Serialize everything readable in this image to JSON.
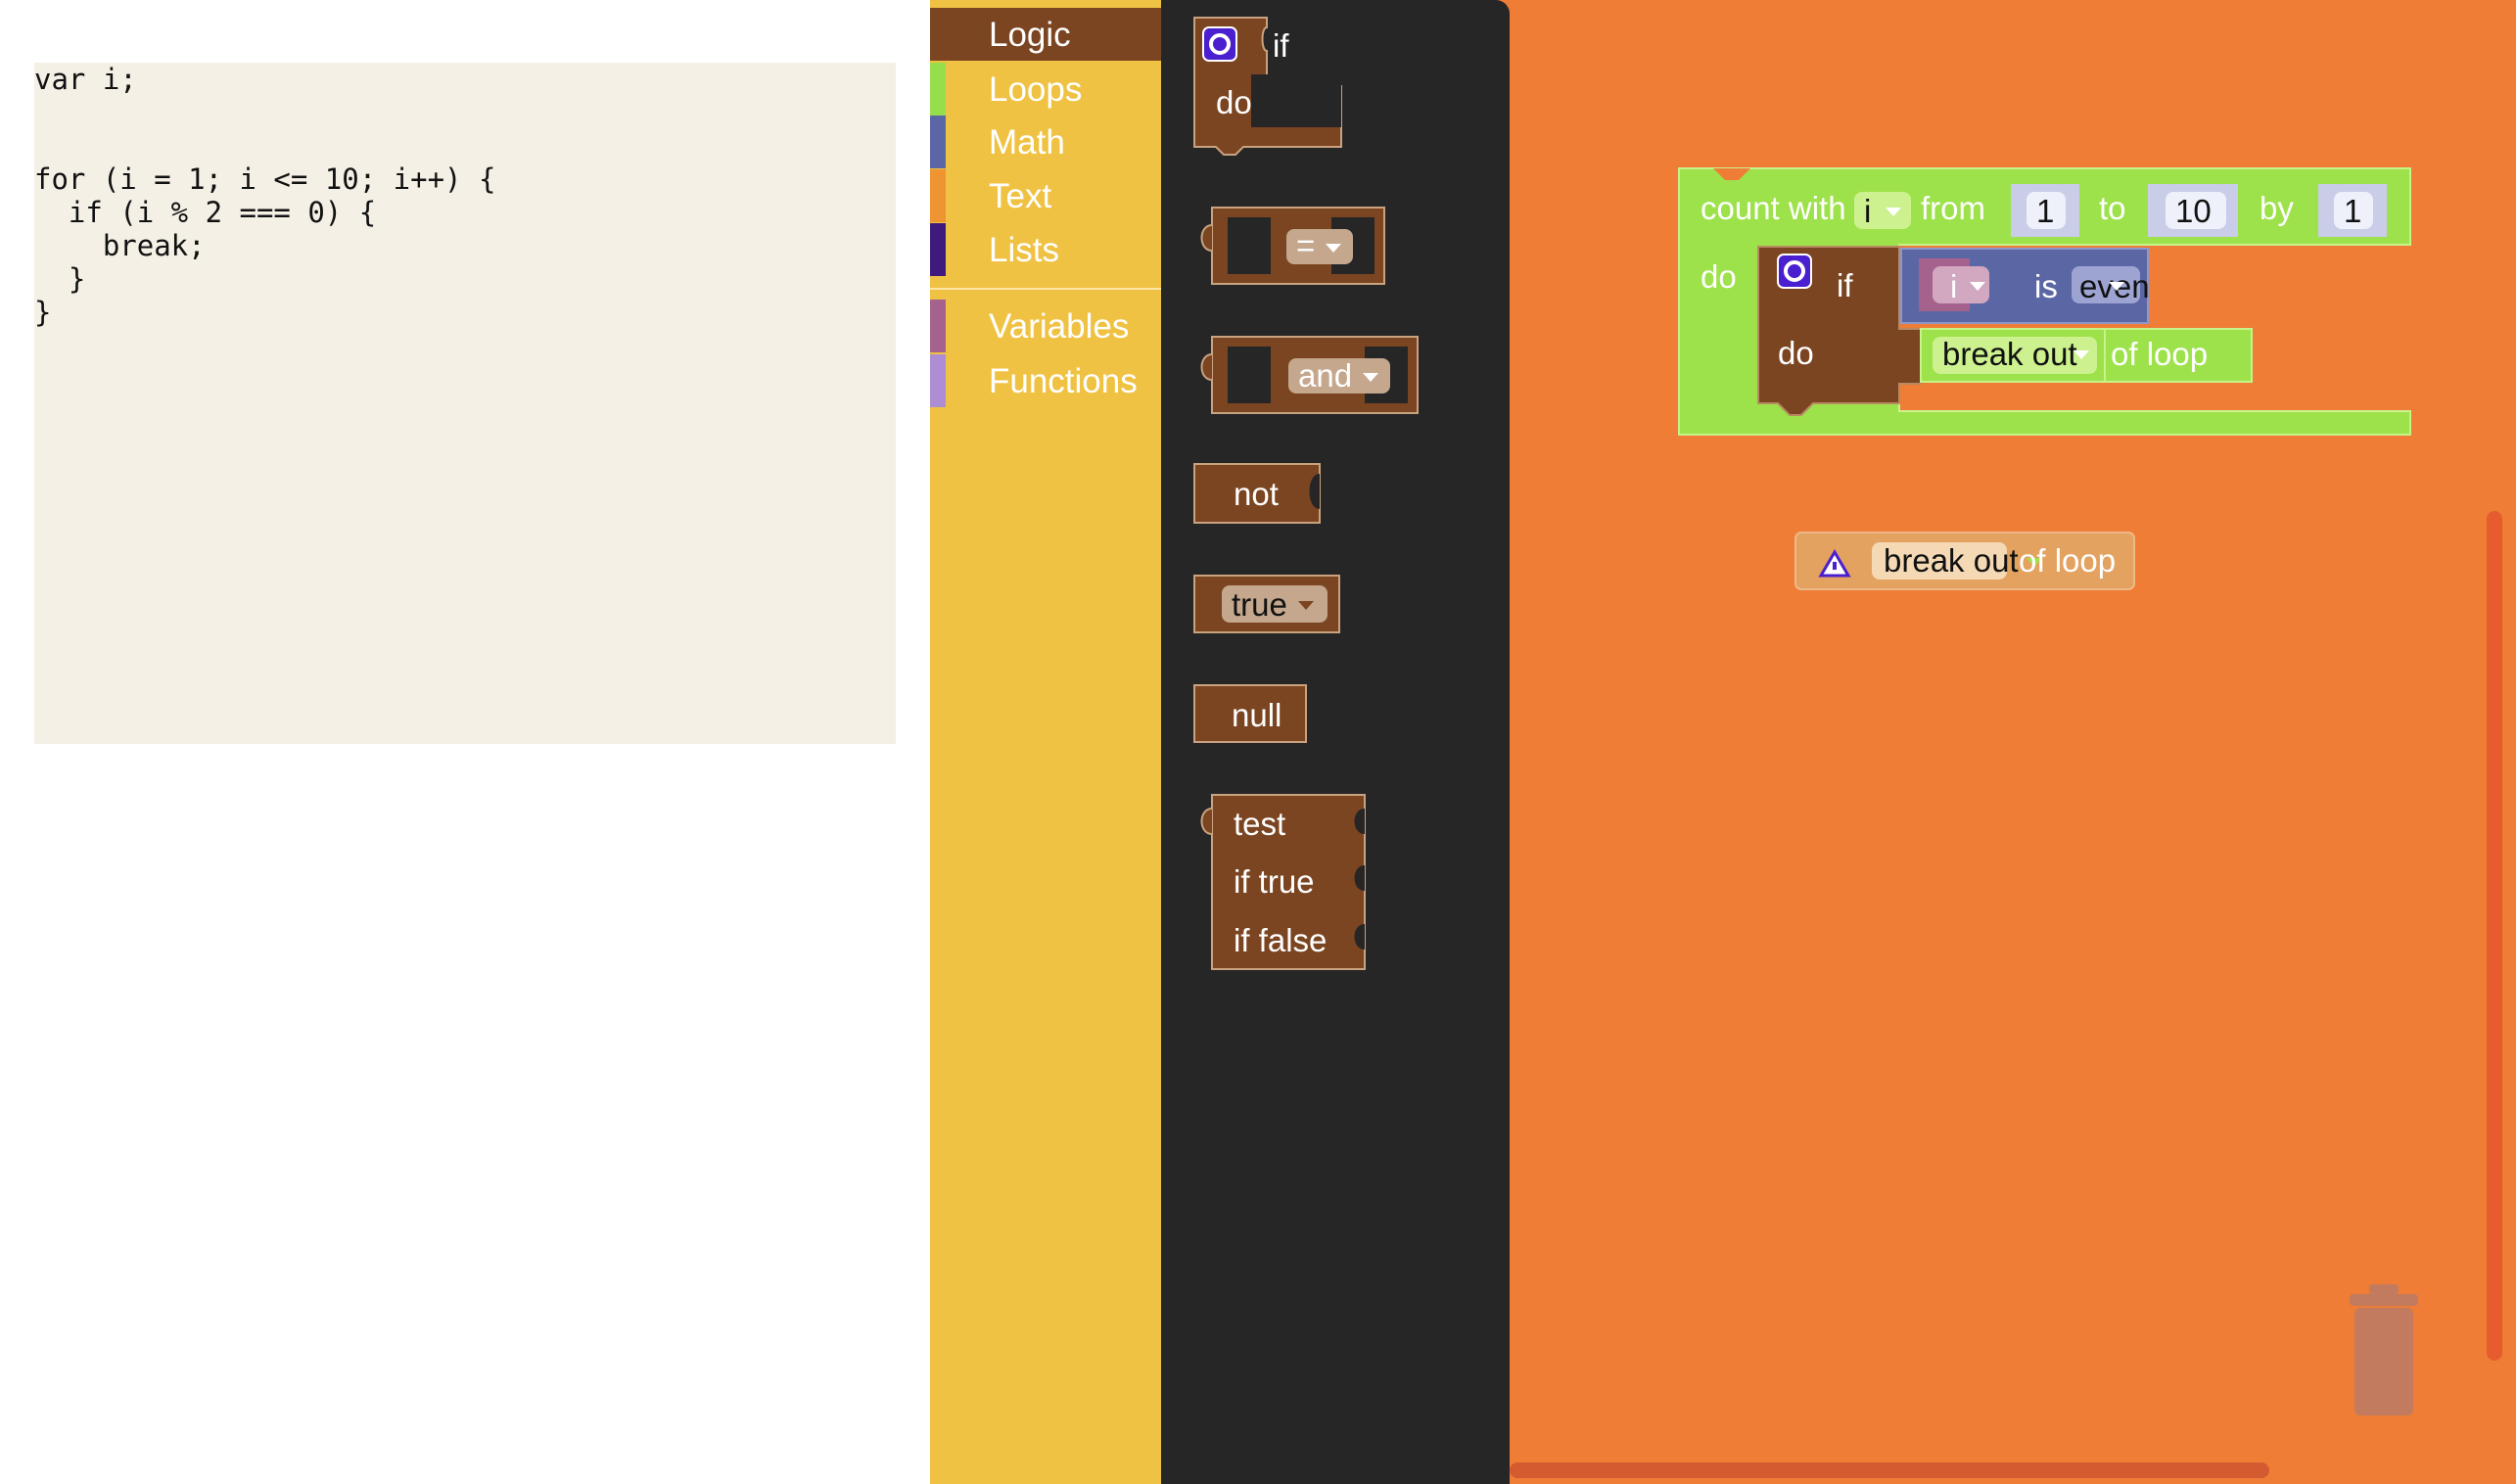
{
  "code": {
    "lines": [
      "var i;",
      "",
      "",
      "for (i = 1; i <= 10; i++) {",
      "  if (i % 2 === 0) {",
      "    break;",
      "  }",
      "}"
    ]
  },
  "toolbox": {
    "categories": [
      {
        "label": "Logic",
        "color": "#7b4521",
        "selected": true
      },
      {
        "label": "Loops",
        "color": "#97de4d"
      },
      {
        "label": "Math",
        "color": "#5b67a5"
      },
      {
        "label": "Text",
        "color": "#ee9431"
      },
      {
        "label": "Lists",
        "color": "#3f1a7d"
      },
      {
        "label": "Variables",
        "color": "#a5628c"
      },
      {
        "label": "Functions",
        "color": "#ad8ed5"
      }
    ]
  },
  "flyout": {
    "if_label": "if",
    "do_label": "do",
    "eq_op": "=",
    "and_op": "and",
    "not_label": "not",
    "true_label": "true",
    "null_label": "null",
    "test_label": "test",
    "if_true_label": "if true",
    "if_false_label": "if false"
  },
  "workspace": {
    "loop": {
      "count_with": "count with",
      "var": "i",
      "from": "from",
      "from_val": "1",
      "to": "to",
      "to_val": "10",
      "by": "by",
      "by_val": "1",
      "do": "do"
    },
    "inner_if": {
      "if": "if",
      "do": "do",
      "var": "i",
      "is": "is",
      "parity": "even",
      "break_dd": "break out",
      "of_loop": "of loop"
    },
    "orphan": {
      "break_dd": "break out",
      "of_loop": "of loop"
    }
  },
  "colors": {
    "logic": "#7b4521",
    "loops": "#9de24b",
    "math": "#5b67a5",
    "workspace": "#ef7d36",
    "toolbox": "#f0c243",
    "flyout": "#262626"
  }
}
